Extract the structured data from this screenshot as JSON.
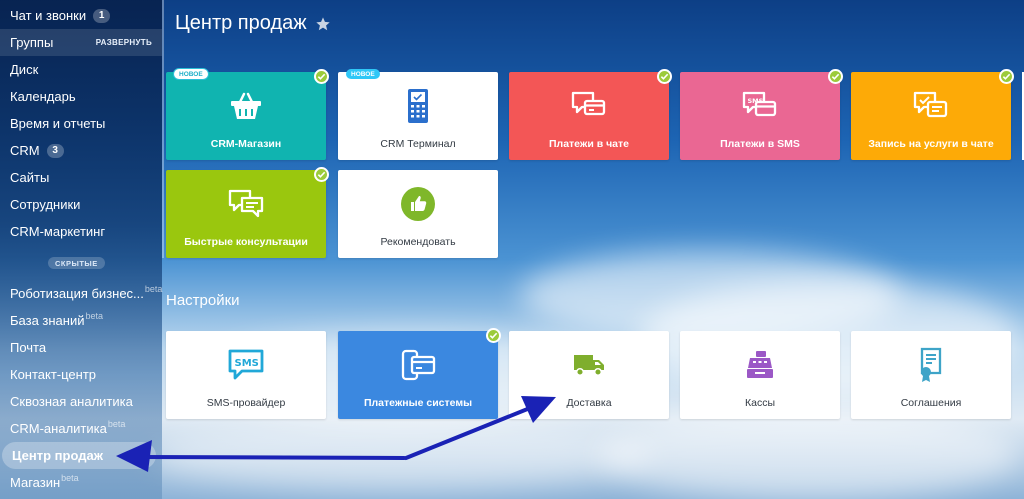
{
  "sidebar": {
    "items": [
      {
        "label": "Чат и звонки",
        "counter": "1"
      },
      {
        "label": "Группы",
        "action": "РАЗВЕРНУТЬ"
      },
      {
        "label": "Диск"
      },
      {
        "label": "Календарь"
      },
      {
        "label": "Время и отчеты"
      },
      {
        "label": "CRM",
        "counter": "3"
      },
      {
        "label": "Сайты"
      },
      {
        "label": "Сотрудники"
      },
      {
        "label": "CRM-маркетинг"
      }
    ],
    "hidden_label": "СКРЫТЫЕ",
    "hidden_items": [
      {
        "label": "Роботизация бизнес...",
        "beta": "beta"
      },
      {
        "label": "База знаний",
        "beta": "beta"
      },
      {
        "label": "Почта"
      },
      {
        "label": "Контакт-центр"
      },
      {
        "label": "Сквозная аналитика"
      },
      {
        "label": "CRM-аналитика",
        "beta": "beta"
      },
      {
        "label": "Центр продаж"
      },
      {
        "label": "Магазин",
        "beta": "beta"
      }
    ]
  },
  "header": {
    "title": "Центр продаж"
  },
  "tiles": [
    {
      "label": "CRM-Магазин",
      "badge": "НОВОЕ",
      "color": "#10b4b0"
    },
    {
      "label": "CRM Терминал",
      "badge": "НОВОЕ"
    },
    {
      "label": "Платежи в чате",
      "color": "#f35656"
    },
    {
      "label": "Платежи в SMS",
      "color": "#ea6793"
    },
    {
      "label": "Запись на услуги в чате",
      "color": "#fdaa07"
    },
    {
      "label": "Быстрые консультации",
      "color": "#9ac70e"
    },
    {
      "label": "Рекомендовать"
    }
  ],
  "settings": {
    "title": "Настройки",
    "tiles": [
      {
        "label": "SMS-провайдер"
      },
      {
        "label": "Платежные системы",
        "color": "#3b88e0"
      },
      {
        "label": "Доставка"
      },
      {
        "label": "Кассы"
      },
      {
        "label": "Соглашения"
      }
    ]
  },
  "icons": {
    "sms_text": "SMS"
  }
}
